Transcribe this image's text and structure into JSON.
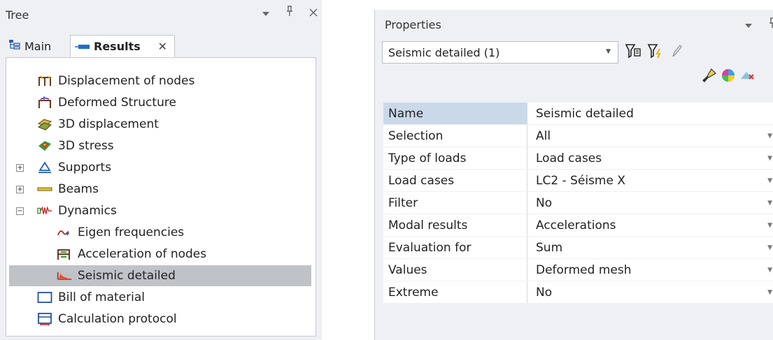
{
  "tree": {
    "title": "Tree",
    "tabs": [
      {
        "label": "Main",
        "icon": "tree-icon"
      },
      {
        "label": "Results",
        "icon": "results-icon"
      }
    ],
    "nodes": [
      {
        "label": "Displacement of nodes",
        "icon": "displacement-nodes-icon"
      },
      {
        "label": "Deformed Structure",
        "icon": "deformed-structure-icon"
      },
      {
        "label": "3D displacement",
        "icon": "3d-displacement-icon"
      },
      {
        "label": "3D stress",
        "icon": "3d-stress-icon"
      },
      {
        "label": "Supports",
        "icon": "supports-icon",
        "expander": "+"
      },
      {
        "label": "Beams",
        "icon": "beams-icon",
        "expander": "+"
      },
      {
        "label": "Dynamics",
        "icon": "dynamics-icon",
        "expander": "−"
      },
      {
        "label": "Eigen frequencies",
        "icon": "eigen-frequencies-icon"
      },
      {
        "label": "Acceleration of nodes",
        "icon": "acceleration-nodes-icon"
      },
      {
        "label": "Seismic detailed",
        "icon": "seismic-icon",
        "selected": true
      },
      {
        "label": "Bill of material",
        "icon": "bill-of-material-icon"
      },
      {
        "label": "Calculation protocol",
        "icon": "calculation-protocol-icon"
      }
    ]
  },
  "properties": {
    "title": "Properties",
    "selector_value": "Seismic detailed (1)",
    "toolbar_icons": [
      "filter-icon",
      "filter-lightning-icon",
      "pencil-icon",
      "brush-icon",
      "color-palette-icon",
      "clear-color-icon"
    ],
    "rows": [
      {
        "name": "Name",
        "value": "Seismic detailed",
        "dropdown": false
      },
      {
        "name": "Selection",
        "value": "All",
        "dropdown": true
      },
      {
        "name": "Type of loads",
        "value": "Load cases",
        "dropdown": true
      },
      {
        "name": "Load cases",
        "value": "LC2 - Séisme X",
        "dropdown": true
      },
      {
        "name": "Filter",
        "value": "No",
        "dropdown": true
      },
      {
        "name": "Modal results",
        "value": "Accelerations",
        "dropdown": true
      },
      {
        "name": "Evaluation for",
        "value": "Sum",
        "dropdown": true
      },
      {
        "name": "Values",
        "value": "Deformed mesh",
        "dropdown": true
      },
      {
        "name": "Extreme",
        "value": "No",
        "dropdown": true
      }
    ]
  },
  "window_controls": {
    "dropdown": "▾",
    "pin": "ᵖ",
    "close": "✕"
  },
  "colors": {
    "selection": "#bfc2c7",
    "name_header": "#c9d9ea",
    "panel_bg": "#eef0f4"
  }
}
